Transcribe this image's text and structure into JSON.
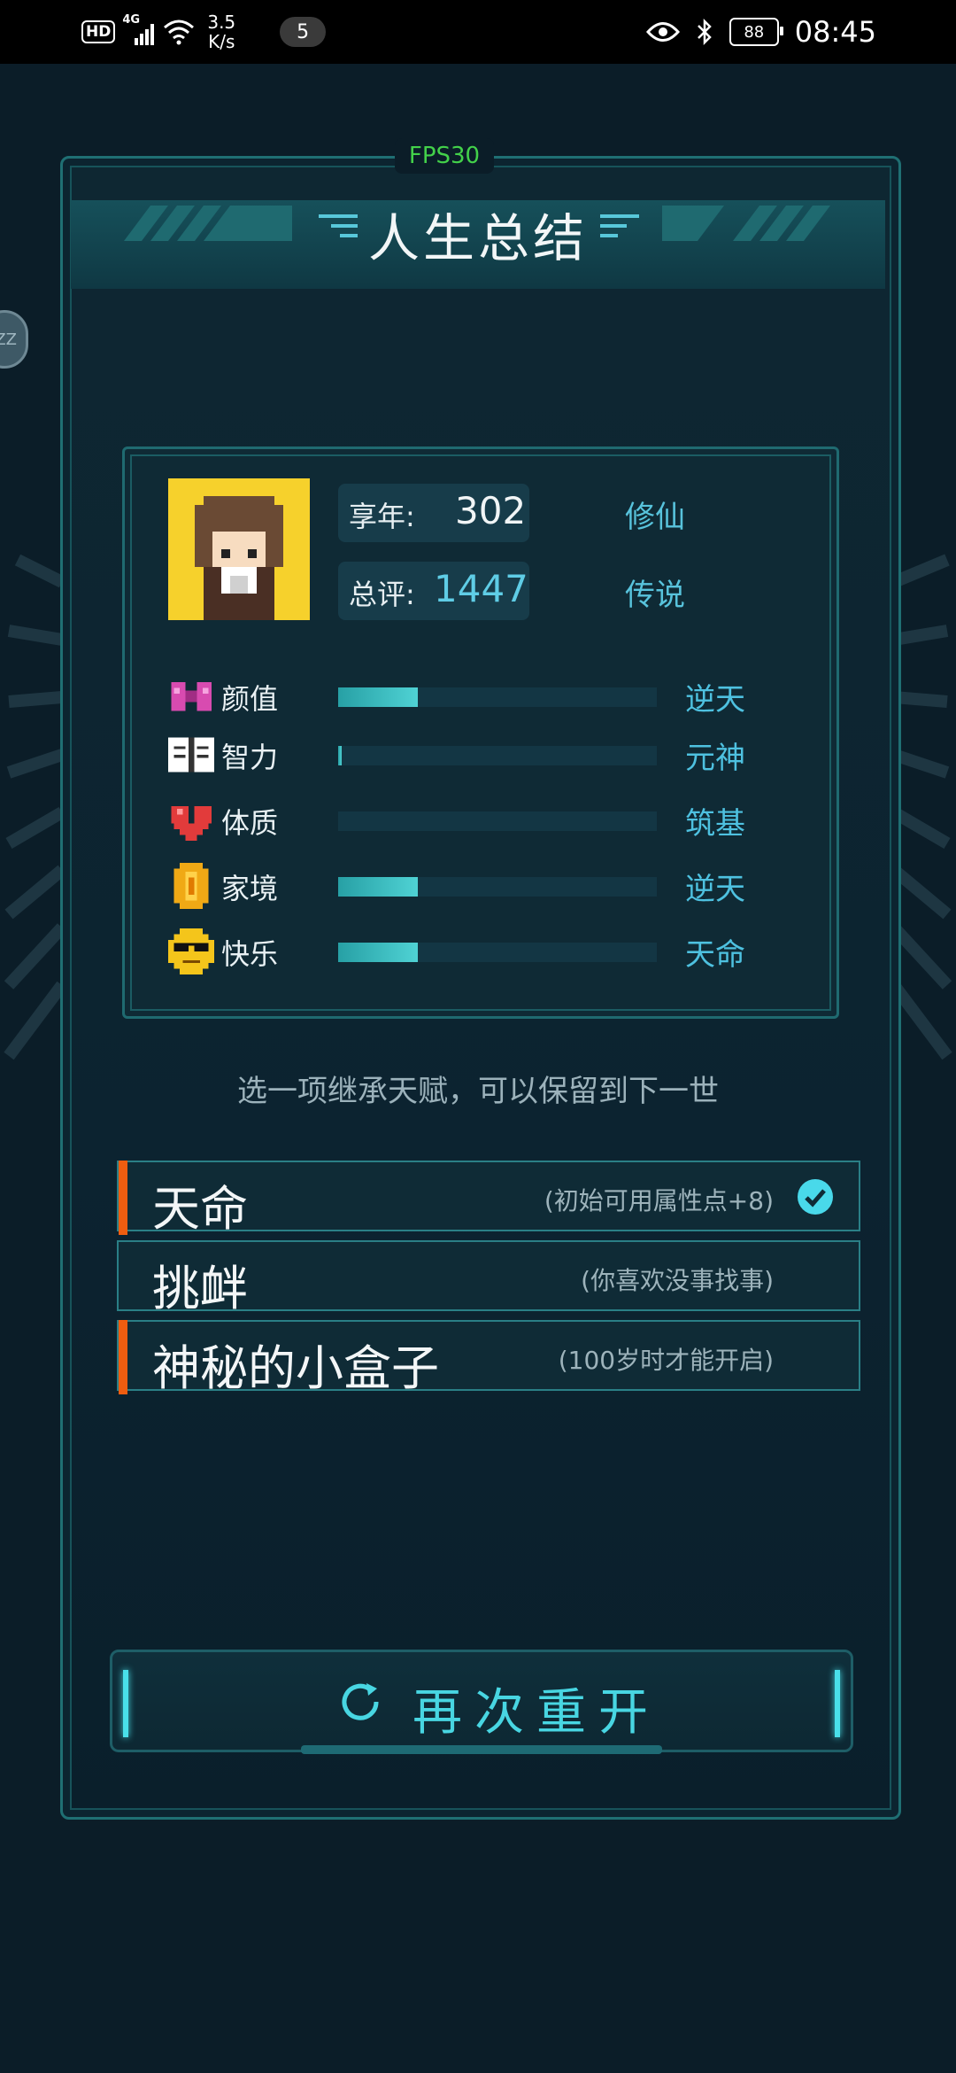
{
  "status_bar": {
    "hd": "HD",
    "network": "4G",
    "speed_value": "3.5",
    "speed_unit": "K/s",
    "notification_count": "5",
    "battery": "88",
    "time": "08:45"
  },
  "fps": "FPS30",
  "title": "人生总结",
  "drag_handle": "ZZ",
  "profile": {
    "age_label": "享年:",
    "age_value": "302",
    "age_rank": "修仙",
    "score_label": "总评:",
    "score_value": "1447",
    "score_rank": "传说"
  },
  "attributes": [
    {
      "icon": "bow-icon",
      "label": "颜值",
      "fill": 0.25,
      "grade": "逆天"
    },
    {
      "icon": "book-icon",
      "label": "智力",
      "fill": 0.01,
      "grade": "元神"
    },
    {
      "icon": "heart-icon",
      "label": "体质",
      "fill": 0.0,
      "grade": "筑基"
    },
    {
      "icon": "coin-icon",
      "label": "家境",
      "fill": 0.25,
      "grade": "逆天"
    },
    {
      "icon": "sunglasses-face-icon",
      "label": "快乐",
      "fill": 0.25,
      "grade": "天命"
    }
  ],
  "hint": "选一项继承天赋，可以保留到下一世",
  "talents": [
    {
      "name": "天命",
      "desc": "(初始可用属性点+8)",
      "selected": true,
      "accent": true
    },
    {
      "name": "挑衅",
      "desc": "(你喜欢没事找事)",
      "selected": false,
      "accent": false
    },
    {
      "name": "神秘的小盒子",
      "desc": "(100岁时才能开启)",
      "selected": false,
      "accent": true
    }
  ],
  "restart_label": "再次重开",
  "colors": {
    "accent_cyan": "#48d6e2",
    "accent_orange": "#ee5d10",
    "fps_green": "#43d14a"
  }
}
